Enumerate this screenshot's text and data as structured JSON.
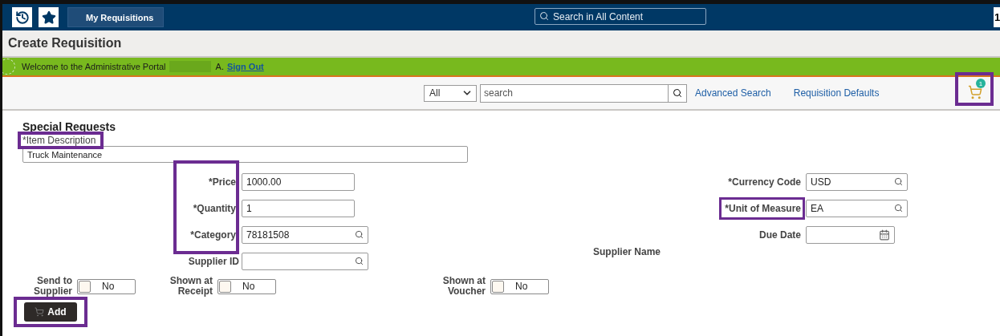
{
  "header": {
    "back_button": "My Requisitions",
    "global_search": {
      "placeholder": "Search in All Content"
    },
    "corner_button": "1"
  },
  "page_title": "Create Requisition",
  "welcome": {
    "text": "Welcome to the Administrative Portal",
    "suffix": "A.",
    "link": "Sign Out"
  },
  "toolbar": {
    "scope": "All",
    "search": {
      "placeholder": "search"
    },
    "links": [
      "Advanced Search",
      "Requisition Defaults"
    ],
    "cart_count": "1",
    "cart_highlighted": true
  },
  "section_title": "Special Requests",
  "item_description": {
    "label": "*Item Description",
    "value": "Truck Maintenance",
    "highlighted": true
  },
  "left_fields_highlighted": true,
  "left_fields": [
    {
      "label": "*Price",
      "value": "1000.00",
      "kind": "text"
    },
    {
      "label": "*Quantity",
      "value": "1",
      "kind": "text"
    },
    {
      "label": "*Category",
      "value": "78181508",
      "kind": "lookup"
    },
    {
      "label": "Supplier ID",
      "kind": "lookup"
    }
  ],
  "right_fields": [
    {
      "label": "*Currency Code",
      "value": "USD",
      "kind": "lookup",
      "highlighted": false
    },
    {
      "label": "*Unit of Measure",
      "value": "EA",
      "kind": "lookup",
      "highlighted": true
    },
    {
      "label": "Due Date",
      "kind": "date",
      "highlighted": false
    }
  ],
  "supplier_name_label": "Supplier Name",
  "toggles": [
    {
      "label": "Send to Supplier",
      "on": false,
      "text": "No"
    },
    {
      "label": "Shown at Receipt",
      "on": false,
      "text": "No"
    },
    {
      "label": "Shown at Voucher",
      "on": false,
      "text": "No"
    }
  ],
  "add_button": {
    "label": "Add",
    "highlighted": true
  }
}
